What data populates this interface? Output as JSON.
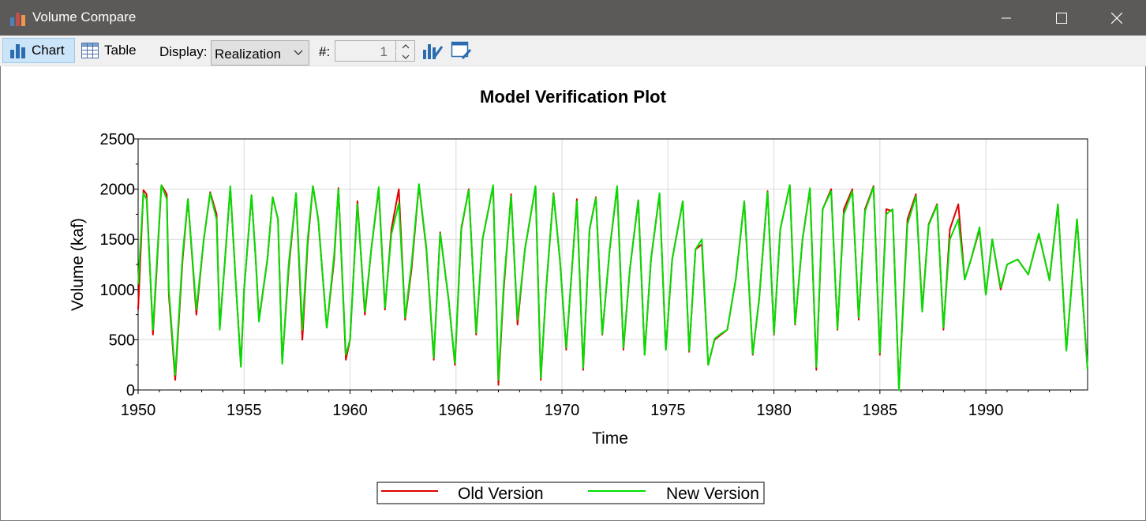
{
  "window": {
    "title": "Volume Compare",
    "minimize_glyph": "—",
    "maximize_glyph": "☐",
    "close_glyph": "✕"
  },
  "toolbar": {
    "chart_label": "Chart",
    "table_label": "Table",
    "display_label": "Display:",
    "display_value": "Realization",
    "number_label": "#:",
    "number_value": "1"
  },
  "icons": {
    "app": "bar-chart-icon",
    "chart": "bar-chart-icon",
    "table": "table-icon",
    "chart_properties": "chart-settings-icon",
    "window_properties": "window-settings-icon"
  },
  "colors": {
    "old_version": "#e00000",
    "new_version": "#00e000",
    "active_tab": "#cce4f7"
  },
  "chart_data": {
    "type": "line",
    "title": "Model Verification Plot",
    "xlabel": "Time",
    "ylabel": "Volume (kaf)",
    "xlim": [
      1950,
      1994.8
    ],
    "ylim": [
      0,
      2500
    ],
    "xticks": [
      1950,
      1955,
      1960,
      1965,
      1970,
      1975,
      1980,
      1985,
      1990
    ],
    "yticks": [
      0,
      500,
      1000,
      1500,
      2000,
      2500
    ],
    "grid": true,
    "legend": "bottom-center",
    "x": [
      1950.0,
      1950.25,
      1950.4,
      1950.7,
      1950.85,
      1951.1,
      1951.35,
      1951.45,
      1951.75,
      1952.1,
      1952.35,
      1952.75,
      1953.1,
      1953.4,
      1953.7,
      1953.85,
      1954.1,
      1954.35,
      1954.6,
      1954.85,
      1955.0,
      1955.35,
      1955.55,
      1955.7,
      1956.1,
      1956.35,
      1956.6,
      1956.8,
      1957.1,
      1957.45,
      1957.75,
      1958.0,
      1958.25,
      1958.5,
      1958.9,
      1959.25,
      1959.45,
      1959.8,
      1960.0,
      1960.35,
      1960.7,
      1961.0,
      1961.35,
      1961.65,
      1961.95,
      1962.3,
      1962.6,
      1962.9,
      1963.25,
      1963.6,
      1963.95,
      1964.25,
      1964.65,
      1964.95,
      1965.25,
      1965.6,
      1965.95,
      1966.25,
      1966.75,
      1967.0,
      1967.25,
      1967.6,
      1967.9,
      1968.25,
      1968.75,
      1969.0,
      1969.25,
      1969.6,
      1969.9,
      1970.2,
      1970.7,
      1971.0,
      1971.3,
      1971.6,
      1971.9,
      1972.25,
      1972.6,
      1972.9,
      1973.2,
      1973.6,
      1973.9,
      1974.2,
      1974.6,
      1974.9,
      1975.2,
      1975.7,
      1976.0,
      1976.3,
      1976.6,
      1976.9,
      1977.2,
      1977.5,
      1977.8,
      1978.2,
      1978.6,
      1979.0,
      1979.3,
      1979.7,
      1980.0,
      1980.3,
      1980.75,
      1981.0,
      1981.35,
      1981.7,
      1982.0,
      1982.3,
      1982.7,
      1983.0,
      1983.3,
      1983.7,
      1984.0,
      1984.3,
      1984.7,
      1985.0,
      1985.3,
      1985.6,
      1985.9,
      1986.3,
      1986.7,
      1987.0,
      1987.3,
      1987.7,
      1988.0,
      1988.3,
      1988.7,
      1989.0,
      1989.3,
      1989.7,
      1990.0,
      1990.3,
      1990.7,
      1991.0,
      1991.5,
      1992.0,
      1992.5,
      1993.0,
      1993.4,
      1993.8,
      1994.3,
      1994.8
    ],
    "series": [
      {
        "name": "Old Version",
        "color": "#e00000",
        "values": [
          800,
          1990,
          1950,
          550,
          1100,
          2040,
          1950,
          950,
          100,
          1300,
          1900,
          750,
          1500,
          1970,
          1750,
          620,
          1300,
          2020,
          1100,
          240,
          1000,
          1940,
          1300,
          700,
          1300,
          1920,
          1700,
          270,
          1200,
          1960,
          500,
          1450,
          2030,
          1700,
          620,
          1300,
          2010,
          300,
          500,
          1880,
          750,
          1400,
          2000,
          800,
          1600,
          2000,
          700,
          1200,
          2040,
          1400,
          300,
          1570,
          900,
          250,
          1600,
          2000,
          550,
          1500,
          2030,
          50,
          1000,
          1950,
          650,
          1400,
          2030,
          100,
          1000,
          1960,
          1300,
          400,
          1900,
          200,
          1600,
          1920,
          550,
          1400,
          2020,
          400,
          1200,
          1890,
          350,
          1300,
          1950,
          400,
          1300,
          1880,
          380,
          1400,
          1450,
          250,
          500,
          550,
          600,
          1100,
          1880,
          350,
          900,
          1980,
          550,
          1600,
          2040,
          650,
          1500,
          2000,
          200,
          1800,
          2000,
          600,
          1800,
          2000,
          700,
          1800,
          2030,
          350,
          1800,
          1780,
          20,
          1700,
          1950,
          800,
          1650,
          1850,
          600,
          1600,
          1850,
          1100,
          1300,
          1600,
          950,
          1500,
          1000,
          1250,
          1300,
          1150,
          1550,
          1100,
          1850,
          400,
          1700,
          200
        ]
      },
      {
        "name": "New Version",
        "color": "#00e000",
        "values": [
          1050,
          1960,
          1900,
          600,
          1150,
          2040,
          1900,
          1000,
          150,
          1350,
          1900,
          800,
          1500,
          1960,
          1700,
          600,
          1300,
          2030,
          1100,
          230,
          1000,
          1940,
          1300,
          680,
          1300,
          1920,
          1700,
          260,
          1250,
          1960,
          600,
          1500,
          2030,
          1700,
          620,
          1350,
          2000,
          350,
          500,
          1850,
          780,
          1400,
          2020,
          820,
          1550,
          1860,
          720,
          1250,
          2050,
          1420,
          320,
          1560,
          900,
          270,
          1620,
          1990,
          570,
          1500,
          2040,
          100,
          1050,
          1930,
          700,
          1400,
          2030,
          120,
          1000,
          1950,
          1300,
          420,
          1880,
          220,
          1600,
          1910,
          560,
          1400,
          2030,
          420,
          1200,
          1890,
          350,
          1300,
          1960,
          400,
          1300,
          1880,
          390,
          1400,
          1500,
          250,
          510,
          560,
          600,
          1100,
          1880,
          360,
          900,
          1970,
          560,
          1600,
          2040,
          660,
          1500,
          2010,
          230,
          1800,
          1980,
          610,
          1750,
          1980,
          720,
          1780,
          2020,
          370,
          1750,
          1800,
          0,
          1650,
          1930,
          780,
          1640,
          1840,
          620,
          1500,
          1700,
          1100,
          1300,
          1620,
          950,
          1500,
          1020,
          1250,
          1300,
          1150,
          1560,
          1090,
          1850,
          390,
          1700,
          200
        ]
      }
    ]
  },
  "legend": {
    "old_label": "Old Version",
    "new_label": "New Version"
  }
}
